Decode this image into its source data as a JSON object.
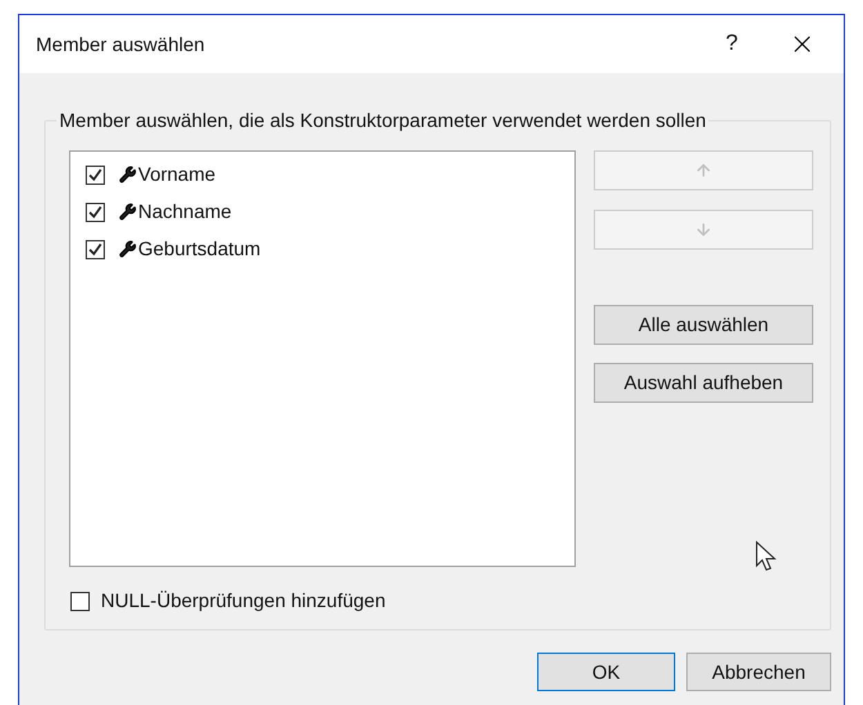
{
  "window": {
    "title": "Member auswählen",
    "help": "?"
  },
  "group": {
    "title": "Member auswählen, die als Konstruktorparameter verwendet werden sollen"
  },
  "members": [
    {
      "name": "Vorname",
      "checked": true
    },
    {
      "name": "Nachname",
      "checked": true
    },
    {
      "name": "Geburtsdatum",
      "checked": true
    }
  ],
  "side_buttons": [
    {
      "kind": "up",
      "disabled": true
    },
    {
      "kind": "down",
      "disabled": true
    },
    {
      "kind": "text",
      "label": "Alle auswählen",
      "disabled": false
    },
    {
      "kind": "text",
      "label": "Auswahl aufheben",
      "disabled": false
    }
  ],
  "null_check": {
    "label": "NULL-Überprüfungen hinzufügen",
    "checked": false
  },
  "buttons": [
    {
      "label": "OK",
      "default": true
    },
    {
      "label": "Abbrechen",
      "default": false
    }
  ]
}
